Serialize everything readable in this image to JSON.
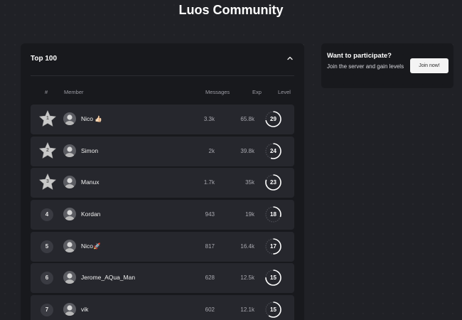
{
  "page": {
    "title": "Luos Community"
  },
  "leaderboard": {
    "title": "Top 100",
    "collapse_icon": "chevron-up-icon",
    "columns": {
      "rank": "#",
      "member": "Member",
      "messages": "Messages",
      "exp": "Exp",
      "level": "Level"
    },
    "rows": [
      {
        "rank": "1",
        "rank_style": "star",
        "name": "Nico 👍🏻",
        "messages": "3.3k",
        "exp": "65.8k",
        "level": "29",
        "level_progress": 0.72
      },
      {
        "rank": "2",
        "rank_style": "star",
        "name": "Simon",
        "messages": "2k",
        "exp": "39.8k",
        "level": "24",
        "level_progress": 0.55
      },
      {
        "rank": "3",
        "rank_style": "star",
        "name": "Manux",
        "messages": "1.7k",
        "exp": "35k",
        "level": "23",
        "level_progress": 0.8
      },
      {
        "rank": "4",
        "rank_style": "circle",
        "name": "Kordan",
        "messages": "943",
        "exp": "19k",
        "level": "18",
        "level_progress": 0.3
      },
      {
        "rank": "5",
        "rank_style": "circle",
        "name": "Nico🚀",
        "messages": "817",
        "exp": "16.4k",
        "level": "17",
        "level_progress": 0.5
      },
      {
        "rank": "6",
        "rank_style": "circle",
        "name": "Jerome_AQua_Man",
        "messages": "628",
        "exp": "12.5k",
        "level": "15",
        "level_progress": 0.75
      },
      {
        "rank": "7",
        "rank_style": "circle",
        "name": "vik",
        "messages": "602",
        "exp": "12.1k",
        "level": "15",
        "level_progress": 0.6
      }
    ]
  },
  "cta": {
    "title": "Want to participate?",
    "text": "Join the server and gain levels",
    "button_label": "Join now!"
  },
  "colors": {
    "background": "#202126",
    "card": "#18191d",
    "row": "#26272d",
    "star": "#c9c9c9",
    "ring_track": "#4a4b52",
    "ring_fill": "#ffffff"
  }
}
